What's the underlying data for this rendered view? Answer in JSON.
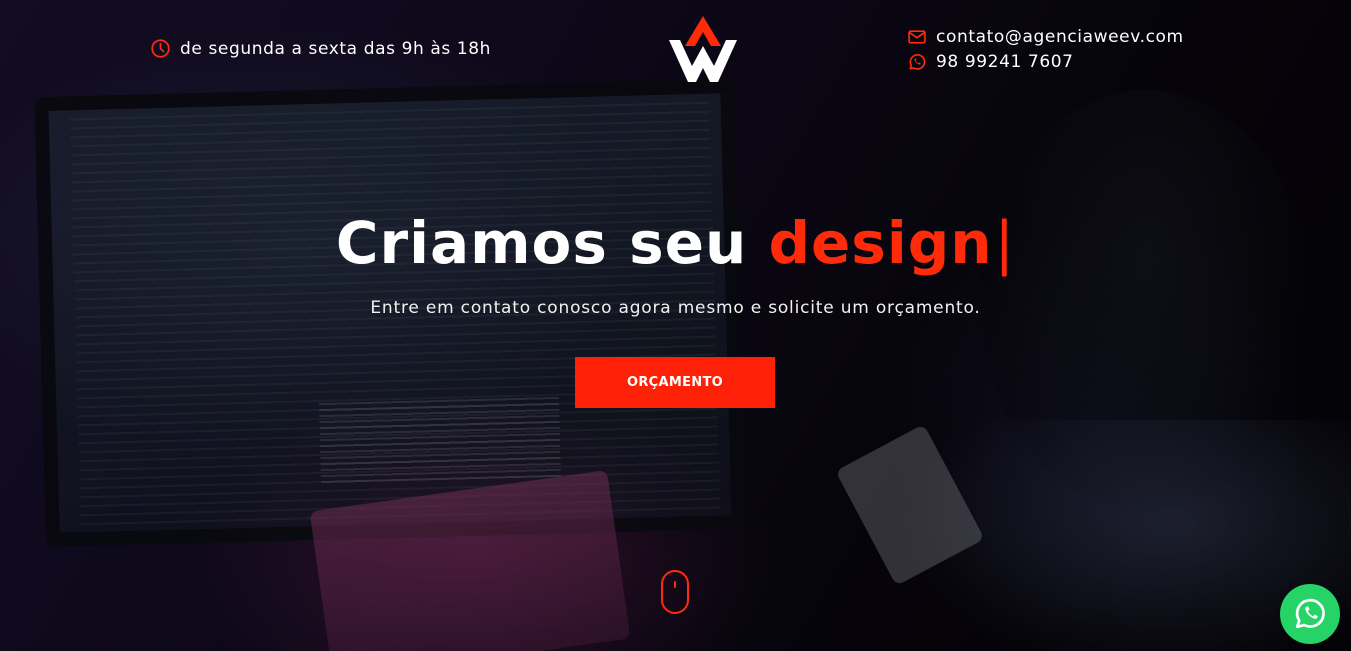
{
  "topbar": {
    "hours_text": "de segunda a sexta das 9h às 18h",
    "email": "contato@agenciaweev.com",
    "phone": "98 99241 7607",
    "icons": [
      "clock-icon",
      "mail-icon",
      "whatsapp-icon"
    ]
  },
  "hero": {
    "headline_prefix": "Criamos seu ",
    "headline_highlight": "design",
    "headline_cursor": "|",
    "subtitle": "Entre em contato conosco agora mesmo e solicite um orçamento.",
    "cta_label": "ORÇAMENTO"
  },
  "colors": {
    "accent": "#ff2a0a",
    "button": "#ff2008",
    "whatsapp": "#25d366",
    "text": "#ffffff"
  }
}
